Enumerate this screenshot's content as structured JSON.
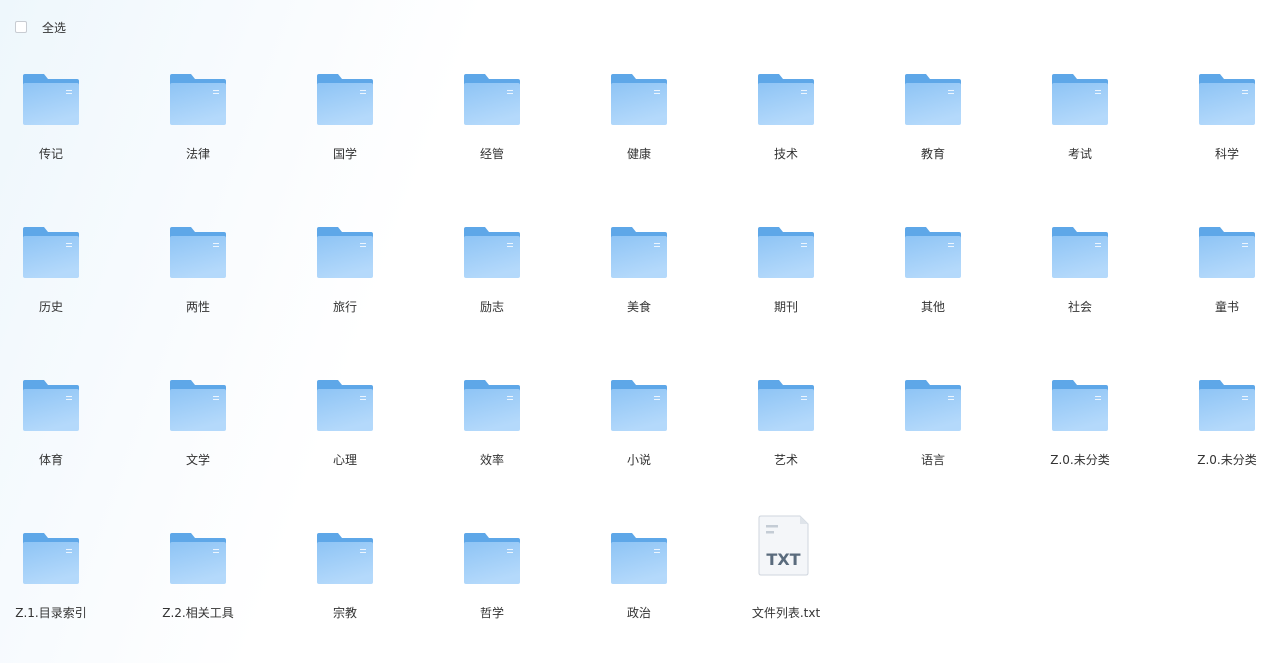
{
  "toolbar": {
    "select_all_label": "全选",
    "select_all_checked": false
  },
  "colors": {
    "folder_back": "#5ea7e8",
    "folder_front_top": "#8ec4f5",
    "folder_front_bottom": "#b4d9fb",
    "txt_text": "#5a6b7d"
  },
  "items": [
    {
      "name": "传记",
      "type": "folder",
      "icon": "folder-icon"
    },
    {
      "name": "法律",
      "type": "folder",
      "icon": "folder-icon"
    },
    {
      "name": "国学",
      "type": "folder",
      "icon": "folder-icon"
    },
    {
      "name": "经管",
      "type": "folder",
      "icon": "folder-icon"
    },
    {
      "name": "健康",
      "type": "folder",
      "icon": "folder-icon"
    },
    {
      "name": "技术",
      "type": "folder",
      "icon": "folder-icon"
    },
    {
      "name": "教育",
      "type": "folder",
      "icon": "folder-icon"
    },
    {
      "name": "考试",
      "type": "folder",
      "icon": "folder-icon"
    },
    {
      "name": "科学",
      "type": "folder",
      "icon": "folder-icon"
    },
    {
      "name": "历史",
      "type": "folder",
      "icon": "folder-icon"
    },
    {
      "name": "两性",
      "type": "folder",
      "icon": "folder-icon"
    },
    {
      "name": "旅行",
      "type": "folder",
      "icon": "folder-icon"
    },
    {
      "name": "励志",
      "type": "folder",
      "icon": "folder-icon"
    },
    {
      "name": "美食",
      "type": "folder",
      "icon": "folder-icon"
    },
    {
      "name": "期刊",
      "type": "folder",
      "icon": "folder-icon"
    },
    {
      "name": "其他",
      "type": "folder",
      "icon": "folder-icon"
    },
    {
      "name": "社会",
      "type": "folder",
      "icon": "folder-icon"
    },
    {
      "name": "童书",
      "type": "folder",
      "icon": "folder-icon"
    },
    {
      "name": "体育",
      "type": "folder",
      "icon": "folder-icon"
    },
    {
      "name": "文学",
      "type": "folder",
      "icon": "folder-icon"
    },
    {
      "name": "心理",
      "type": "folder",
      "icon": "folder-icon"
    },
    {
      "name": "效率",
      "type": "folder",
      "icon": "folder-icon"
    },
    {
      "name": "小说",
      "type": "folder",
      "icon": "folder-icon"
    },
    {
      "name": "艺术",
      "type": "folder",
      "icon": "folder-icon"
    },
    {
      "name": "语言",
      "type": "folder",
      "icon": "folder-icon"
    },
    {
      "name": "Z.0.未分类",
      "type": "folder",
      "icon": "folder-icon"
    },
    {
      "name": "Z.0.未分类",
      "type": "folder",
      "icon": "folder-icon"
    },
    {
      "name": "Z.1.目录索引",
      "type": "folder",
      "icon": "folder-icon"
    },
    {
      "name": "Z.2.相关工具",
      "type": "folder",
      "icon": "folder-icon"
    },
    {
      "name": "宗教",
      "type": "folder",
      "icon": "folder-icon"
    },
    {
      "name": "哲学",
      "type": "folder",
      "icon": "folder-icon"
    },
    {
      "name": "政治",
      "type": "folder",
      "icon": "folder-icon"
    },
    {
      "name": "文件列表.txt",
      "type": "txt",
      "icon": "txt-file-icon",
      "icon_text": "TXT"
    }
  ]
}
